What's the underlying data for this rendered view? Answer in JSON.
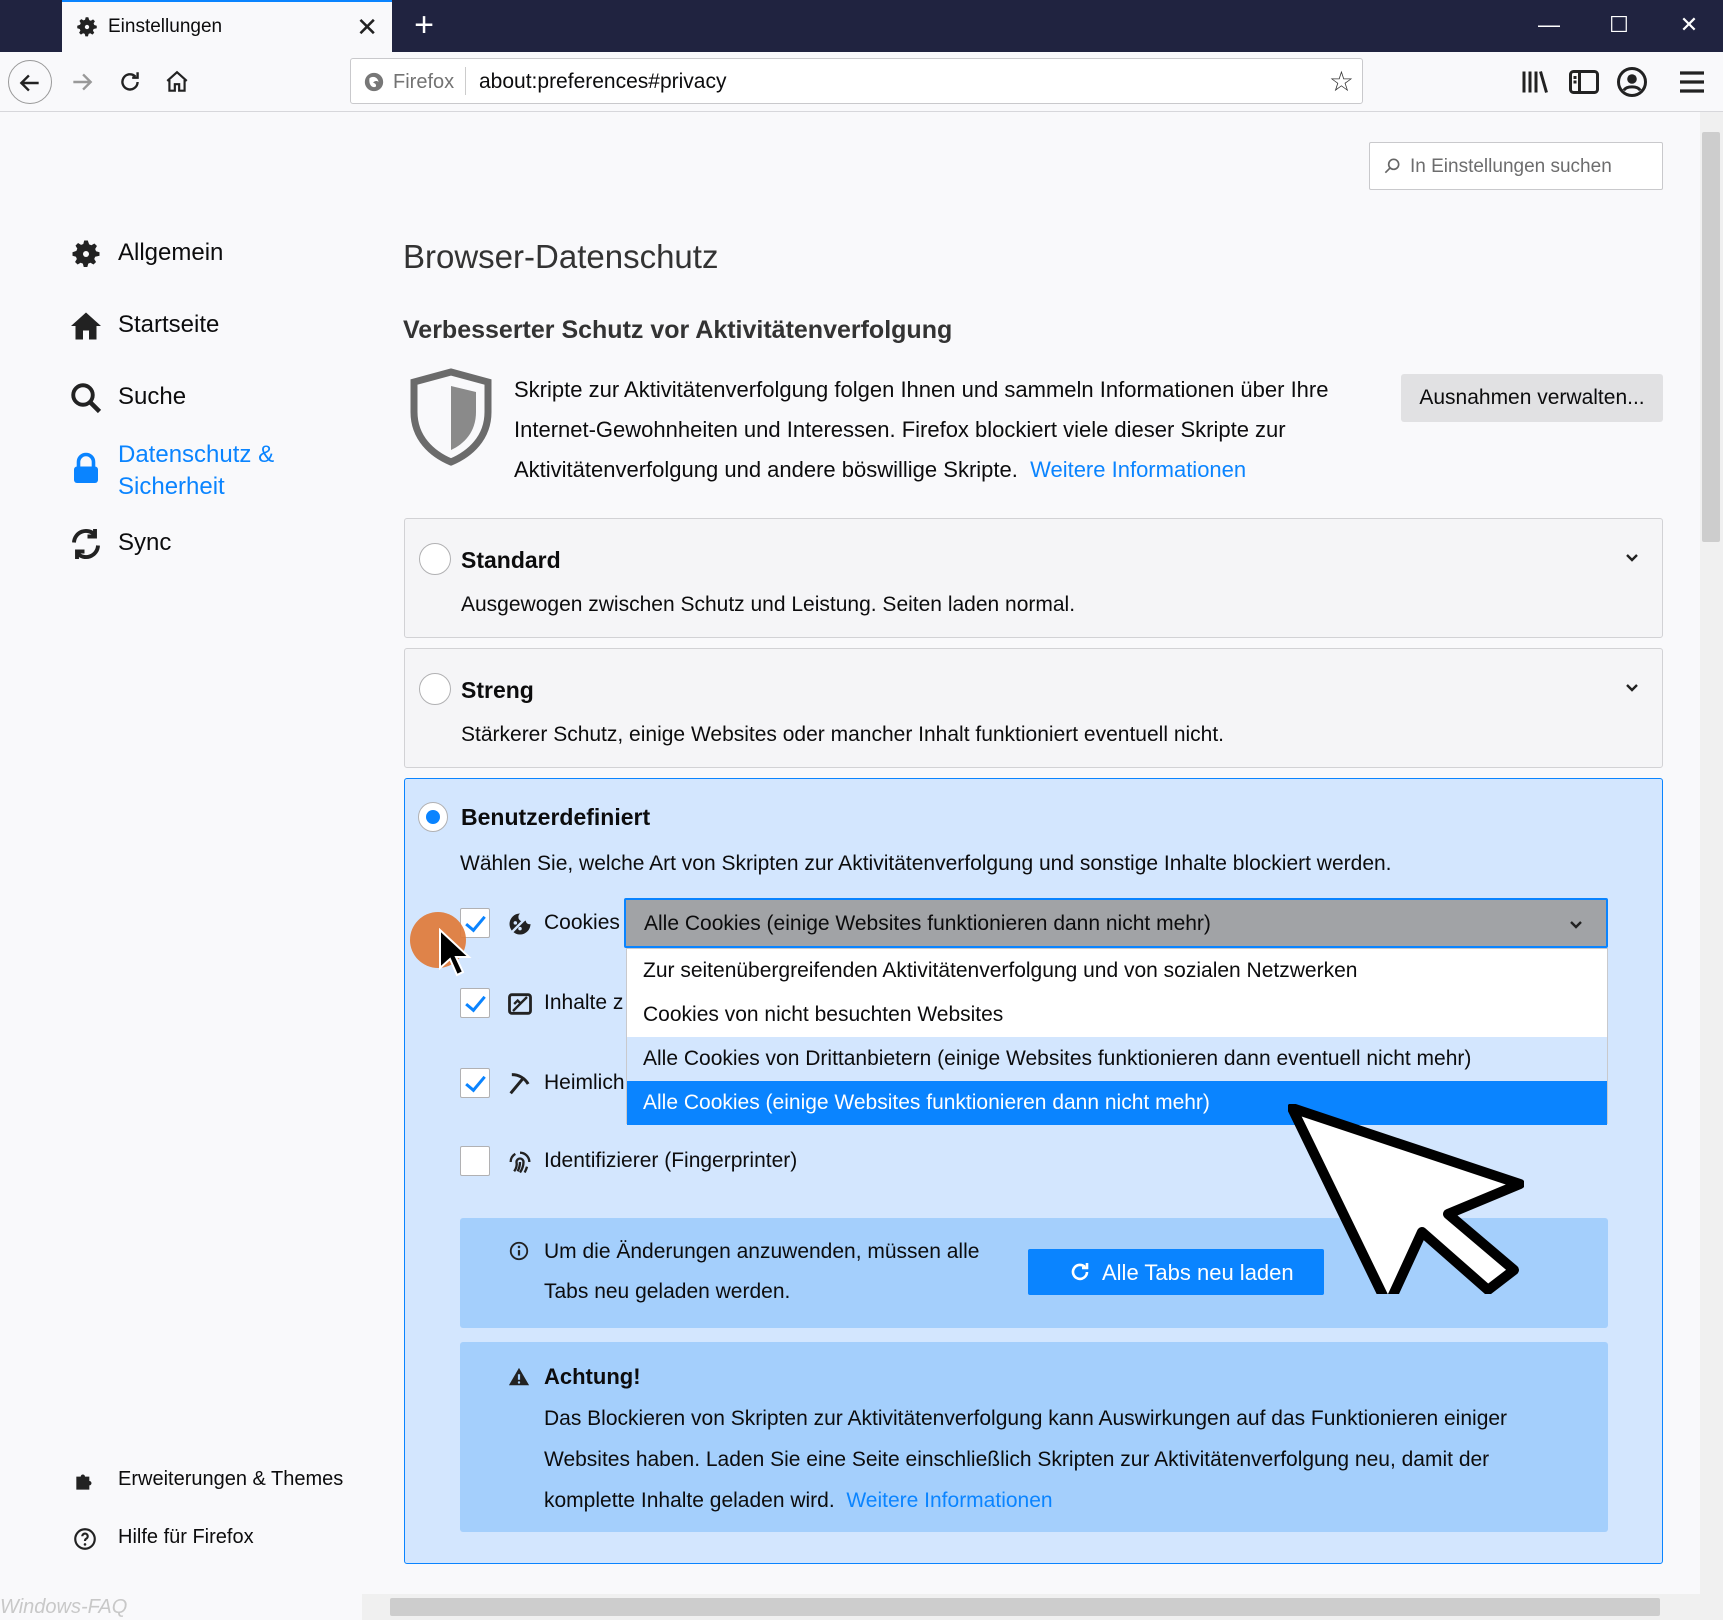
{
  "browser": {
    "tab_title": "Einstellungen",
    "new_tab_label": "+",
    "identity_label": "Firefox",
    "url": "about:preferences#privacy"
  },
  "search": {
    "placeholder": "In Einstellungen suchen"
  },
  "sidebar": {
    "items": [
      {
        "label": "Allgemein",
        "icon": "gear-icon"
      },
      {
        "label": "Startseite",
        "icon": "home-icon"
      },
      {
        "label": "Suche",
        "icon": "search-icon"
      },
      {
        "label": "Datenschutz &",
        "label2": "Sicherheit",
        "icon": "lock-icon",
        "selected": true
      },
      {
        "label": "Sync",
        "icon": "sync-icon"
      }
    ],
    "footer": [
      {
        "label": "Erweiterungen & Themes",
        "icon": "puzzle-icon"
      },
      {
        "label": "Hilfe für Firefox",
        "icon": "help-icon"
      }
    ]
  },
  "main": {
    "heading": "Browser-Datenschutz",
    "etp_heading": "Verbesserter Schutz vor Aktivitätenverfolgung",
    "etp_description": "Skripte zur Aktivitätenverfolgung folgen Ihnen und sammeln Informationen über Ihre Internet-Gewohnheiten und Interessen. Firefox blockiert viele dieser Skripte zur Aktivitätenverfolgung und andere böswillige Skripte.",
    "etp_link": "Weitere Informationen",
    "exceptions_button": "Ausnahmen verwalten...",
    "standard": {
      "title": "Standard",
      "description": "Ausgewogen zwischen Schutz und Leistung. Seiten laden normal."
    },
    "strict": {
      "title": "Streng",
      "description": "Stärkerer Schutz, einige Websites oder mancher Inhalt funktioniert eventuell nicht."
    },
    "custom": {
      "title": "Benutzerdefiniert",
      "description": "Wählen Sie, welche Art von Skripten zur Aktivitätenverfolgung und sonstige Inhalte blockiert werden.",
      "options": [
        {
          "label": "Cookies",
          "checked": true,
          "icon": "cookie-icon"
        },
        {
          "label": "Inhalte z",
          "checked": true,
          "icon": "content-block-icon"
        },
        {
          "label": "Heimlich",
          "checked": true,
          "icon": "cryptominer-icon"
        },
        {
          "label": "Identifizierer (Fingerprinter)",
          "checked": false,
          "icon": "fingerprint-icon"
        }
      ],
      "cookie_select": {
        "value": "Alle Cookies (einige Websites funktionieren dann nicht mehr)",
        "options": [
          "Zur seitenübergreifenden Aktivitätenverfolgung und von sozialen Netzwerken",
          "Cookies von nicht besuchten Websites",
          "Alle Cookies von Drittanbietern (einige Websites funktionieren dann eventuell nicht mehr)",
          "Alle Cookies (einige Websites funktionieren dann nicht mehr)"
        ],
        "hovered_index": 2,
        "selected_index": 3
      },
      "reload_notice": "Um die Änderungen anzuwenden, müssen alle Tabs neu geladen werden.",
      "reload_button": "Alle Tabs neu laden",
      "warning_title": "Achtung!",
      "warning_text": "Das Blockieren von Skripten zur Aktivitätenverfolgung kann Auswirkungen auf das Funktionieren einiger Websites haben. Laden Sie eine Seite einschließlich Skripten zur Aktivitätenverfolgung neu, damit der komplette Inhalte geladen wird.",
      "warning_link": "Weitere Informationen"
    }
  },
  "watermark": "Windows-FAQ",
  "colors": {
    "accent": "#0a84ff",
    "titlebar": "#202340",
    "custom_bg": "#d3e6fe",
    "notice_bg": "#a4cffc"
  }
}
